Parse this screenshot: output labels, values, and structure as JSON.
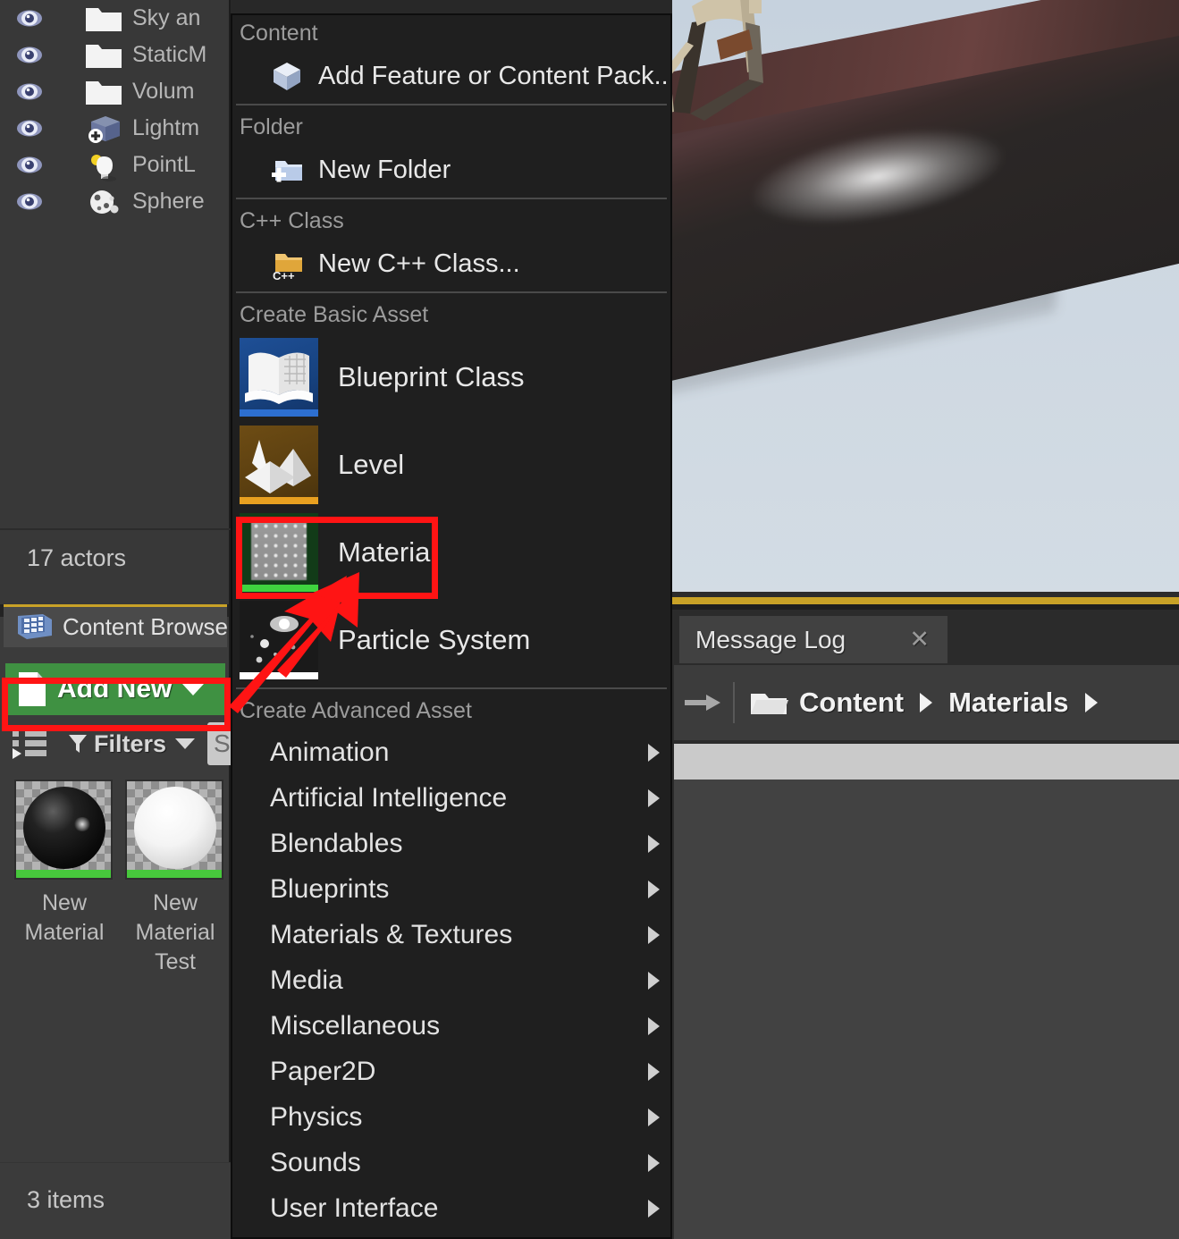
{
  "outliner": {
    "rows": [
      {
        "label": "Sky an",
        "icon": "folder-icon",
        "expandable": true
      },
      {
        "label": "StaticM",
        "icon": "folder-icon",
        "expandable": true
      },
      {
        "label": "Volum",
        "icon": "folder-icon",
        "expandable": true
      },
      {
        "label": "Lightm",
        "icon": "lightmass-importance-volume-icon",
        "expandable": false
      },
      {
        "label": "PointL",
        "icon": "point-light-icon",
        "expandable": false
      },
      {
        "label": "Sphere",
        "icon": "sphere-reflection-capture-icon",
        "expandable": false
      }
    ],
    "actor_count": "17 actors"
  },
  "content_browser": {
    "tab_label": "Content Browse",
    "tab_icon": "content-browser-icon",
    "add_new_label": "Add New",
    "add_new_icon": "new-document-icon",
    "view_options_icon": "view-options-icon",
    "filters_label": "Filters",
    "filters_icon": "funnel-icon",
    "search_value": "S",
    "search_placeholder": "Search Materials",
    "assets": [
      {
        "name": "New\nMaterial",
        "type": "material",
        "shade": "dark"
      },
      {
        "name": "New\nMaterial\nTest",
        "type": "material",
        "shade": "light"
      }
    ],
    "item_count": "3 items"
  },
  "right_dock": {
    "message_log_tab": "Message Log",
    "close_icon": "close-icon",
    "breadcrumb": {
      "nav_icon": "forward-arrow-icon",
      "folder_icon": "folder-open-icon",
      "items": [
        "Content",
        "Materials"
      ]
    }
  },
  "viewport": {
    "help_icon": "help-icon",
    "help_glyph": "?"
  },
  "menu": {
    "sections": [
      {
        "heading": "Content",
        "items": [
          {
            "label": "Add Feature or Content Pack...",
            "icon": "content-pack-icon",
            "kind": "small"
          }
        ]
      },
      {
        "heading": "Folder",
        "items": [
          {
            "label": "New Folder",
            "icon": "new-folder-icon",
            "kind": "small"
          }
        ]
      },
      {
        "heading": "C++ Class",
        "items": [
          {
            "label": "New C++ Class...",
            "icon": "cpp-class-icon",
            "kind": "small"
          }
        ]
      },
      {
        "heading": "Create Basic Asset",
        "items": [
          {
            "label": "Blueprint Class",
            "icon": "blueprint-class-icon",
            "kind": "big",
            "accent": "#2d6fd0"
          },
          {
            "label": "Level",
            "icon": "level-icon",
            "kind": "big",
            "accent": "#e8a020"
          },
          {
            "label": "Material",
            "icon": "material-icon",
            "kind": "big",
            "accent": "#3fd33f",
            "highlighted": true
          },
          {
            "label": "Particle System",
            "icon": "particle-system-icon",
            "kind": "big",
            "accent": "#ffffff"
          }
        ]
      },
      {
        "heading": "Create Advanced Asset",
        "items": [
          {
            "label": "Animation",
            "kind": "submenu"
          },
          {
            "label": "Artificial Intelligence",
            "kind": "submenu"
          },
          {
            "label": "Blendables",
            "kind": "submenu"
          },
          {
            "label": "Blueprints",
            "kind": "submenu"
          },
          {
            "label": "Materials & Textures",
            "kind": "submenu"
          },
          {
            "label": "Media",
            "kind": "submenu"
          },
          {
            "label": "Miscellaneous",
            "kind": "submenu"
          },
          {
            "label": "Paper2D",
            "kind": "submenu"
          },
          {
            "label": "Physics",
            "kind": "submenu"
          },
          {
            "label": "Sounds",
            "kind": "submenu"
          },
          {
            "label": "User Interface",
            "kind": "submenu"
          }
        ]
      }
    ]
  },
  "annotation": {
    "highlight_color": "#ff1414",
    "targets": [
      "add-new-button",
      "menu-item-material"
    ]
  }
}
